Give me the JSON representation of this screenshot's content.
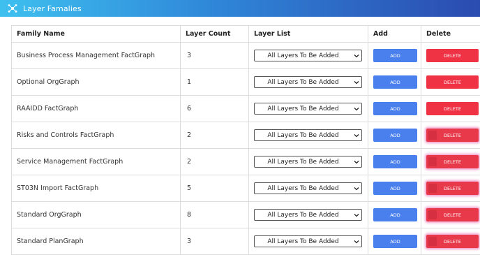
{
  "header": {
    "title": "Layer Famalies",
    "icon": "network-nodes-icon"
  },
  "table": {
    "columns": [
      "Family Name",
      "Layer Count",
      "Layer List",
      "Add",
      "Delete"
    ],
    "select_default": "All Layers To Be Added",
    "add_label": "ADD",
    "delete_label": "DELETE",
    "rows": [
      {
        "name": "Business Process Management FactGraph",
        "count": "3"
      },
      {
        "name": "Optional OrgGraph",
        "count": "1"
      },
      {
        "name": "RAAIDD FactGraph",
        "count": "6"
      },
      {
        "name": "Risks and Controls FactGraph",
        "count": "2"
      },
      {
        "name": "Service Management FactGraph",
        "count": "2"
      },
      {
        "name": "ST03N Import FactGraph",
        "count": "5"
      },
      {
        "name": "Standard OrgGraph",
        "count": "8"
      },
      {
        "name": "Standard PlanGraph",
        "count": "3"
      }
    ]
  },
  "colors": {
    "header_start": "#3ec0ef",
    "header_end": "#2b4bb0",
    "add_button": "#4a80ee",
    "delete_button": "#ef3345"
  }
}
